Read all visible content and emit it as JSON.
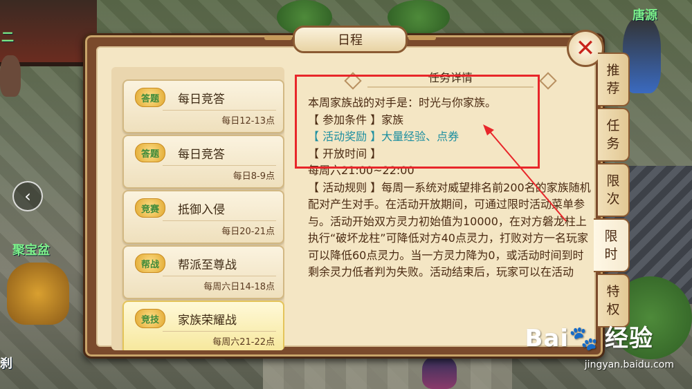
{
  "scene": {
    "labels": [
      "二",
      "聚宝盆",
      "唐源",
      "刹"
    ]
  },
  "dialog": {
    "title": "日程",
    "close_icon": "close-icon"
  },
  "schedule_list": [
    {
      "badge": "答题",
      "name": "每日竞答",
      "time": "每日12-13点",
      "selected": false
    },
    {
      "badge": "答题",
      "name": "每日竞答",
      "time": "每日8-9点",
      "selected": false
    },
    {
      "badge": "竞赛",
      "name": "抵御入侵",
      "time": "每日20-21点",
      "selected": false
    },
    {
      "badge": "帮战",
      "name": "帮派至尊战",
      "time": "每周六日14-18点",
      "selected": false
    },
    {
      "badge": "竞技",
      "name": "家族荣耀战",
      "time": "每周六21-22点",
      "selected": true
    }
  ],
  "detail": {
    "header": "任务详情",
    "opponent": "本周家族战的对手是：时光与你家族。",
    "condition": "【 参加条件 】家族",
    "reward": "【 活动奖励 】大量经验、点券",
    "open_time_label": "【 开放时间 】",
    "open_time": "每周六21:00~22:00",
    "rules": "【 活动规则 】每周一系统对威望排名前200名的家族随机配对产生对手。在活动开放期间，可通过限时活动菜单参与。活动开始双方灵力初始值为10000，在对方磐龙柱上执行“破坏龙柱”可降低对方40点灵力，打败对方一名玩家可以降低60点灵力。当一方灵力降为0，或活动时间到时剩余灵力低者判为失败。活动结束后，玩家可以在活动"
  },
  "side_tabs": [
    {
      "label": [
        "推",
        "荐"
      ],
      "active": false
    },
    {
      "label": [
        "任",
        "务"
      ],
      "active": false
    },
    {
      "label": [
        "限",
        "次"
      ],
      "active": false
    },
    {
      "label": [
        "限",
        "时"
      ],
      "active": true
    },
    {
      "label": [
        "特",
        "权"
      ],
      "active": false
    }
  ],
  "watermark": {
    "brand": "Bai",
    "brand_suffix": "经验",
    "url": "jingyan.baidu.com"
  },
  "colors": {
    "highlight": "#1d8fa0",
    "annotation": "#e8262a"
  }
}
